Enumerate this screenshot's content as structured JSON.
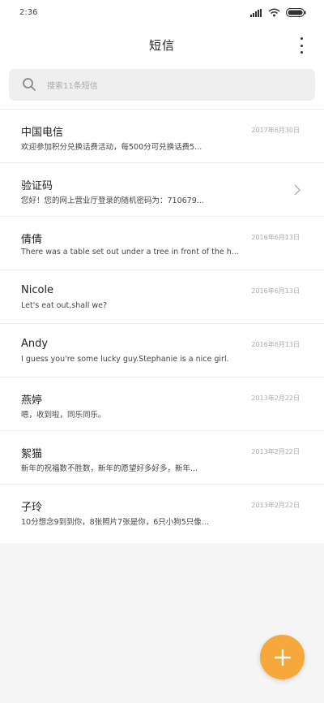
{
  "status_bar": {
    "time": "2:36",
    "icons": [
      "signal-icon",
      "wifi-icon",
      "battery-icon"
    ]
  },
  "header": {
    "title": "短信",
    "menu_icon": "more-vertical-icon"
  },
  "search": {
    "icon": "search-icon",
    "placeholder": "搜索11条短信"
  },
  "messages": [
    {
      "sender": "中国电信",
      "preview": "欢迎参加积分兑换话费活动，每500分可兑换话费5...",
      "date": "2017年6月30日"
    },
    {
      "sender": "验证码",
      "preview": "您好！您的网上营业厅登录的随机密码为：710679...",
      "date": "",
      "has_chevron": true
    },
    {
      "sender": "倩倩",
      "preview": "There was a table set out under a tree in front of the h...",
      "date": "2016年6月13日"
    },
    {
      "sender": "Nicole",
      "preview": "Let's eat out,shall we?",
      "date": "2016年6月13日"
    },
    {
      "sender": "Andy",
      "preview": "I guess you're some lucky guy.Stephanie is a nice girl.",
      "date": "2016年6月13日"
    },
    {
      "sender": "燕婷",
      "preview": "嗯，收到啦，同乐同乐。",
      "date": "2013年2月22日"
    },
    {
      "sender": "絮猫",
      "preview": "新年的祝福数不胜数，新年的愿望好多好多，新年...",
      "date": "2013年2月22日"
    },
    {
      "sender": "子玲",
      "preview": "10分想念9到到你，8张照片7张是你，6只小狗5只像...",
      "date": "2013年2月22日"
    }
  ],
  "fab": {
    "icon": "plus-icon",
    "color": "#f6a83b"
  },
  "colors": {
    "accent": "#f6a83b",
    "background": "#f5f5f5",
    "divider": "#ececec"
  }
}
